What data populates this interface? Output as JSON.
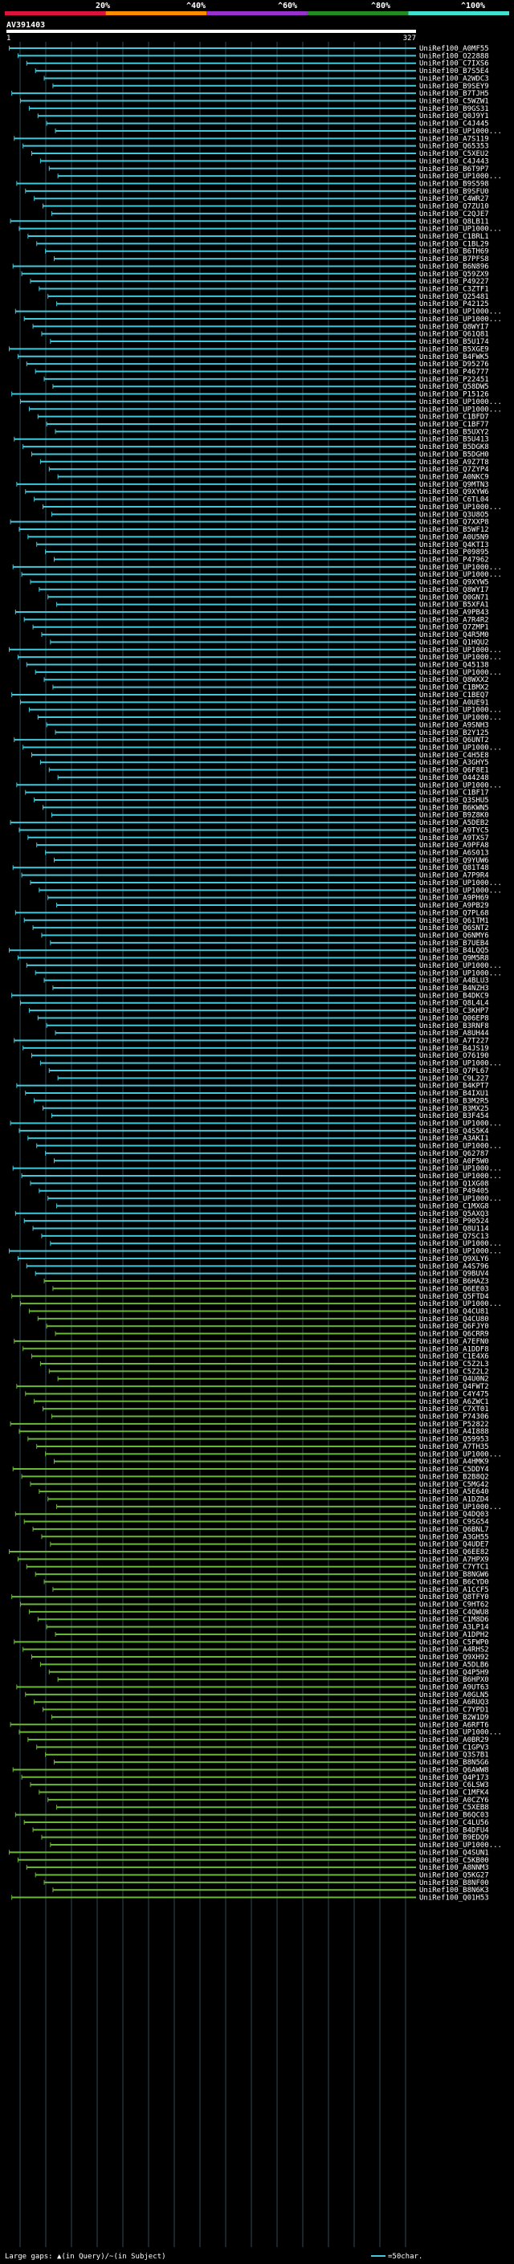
{
  "chart_data": {
    "type": "alignment",
    "query_id": "AV391403",
    "query_start": "1",
    "query_end": "327",
    "identity_scale": [
      "20%",
      "^40%",
      "^60%",
      "^80%",
      "^100%"
    ],
    "colors": {
      "scale": [
        "#dc143c",
        "#ff8c00",
        "#9932cc",
        "#228b22",
        "#40e0d0"
      ],
      "cyan_hit": "#40c8dc",
      "green_hit": "#6ab838",
      "gridline": "#2e4a5a",
      "axis": "#ffffff"
    },
    "footer": {
      "gaps": "Large gaps: ▲(in Query)/~(in Subject)",
      "legend": "=50char."
    },
    "groups": [
      {
        "color": "cyan",
        "labels": [
          "UniRef100_A0MF55",
          "UniRef100_O22888",
          "UniRef100_C7IXS6",
          "UniRef100_B7S5E4",
          "UniRef100_A2WDC3",
          "UniRef100_B9SEY9",
          "UniRef100_B7TJH5",
          "UniRef100_C5WZW1",
          "UniRef100_B9GS31",
          "UniRef100_Q0J9Y1",
          "UniRef100_C4J445",
          "UniRef100_UP1000...",
          "UniRef100_A7S119",
          "UniRef100_Q65353",
          "UniRef100_C5XEU2",
          "UniRef100_C4J443",
          "UniRef100_B6T9P7",
          "UniRef100_UP1000...",
          "UniRef100_B9S598",
          "UniRef100_B9SFU0",
          "UniRef100_C4WR27",
          "UniRef100_Q7ZU10",
          "UniRef100_C2QJE7",
          "UniRef100_Q8LB11",
          "UniRef100_UP1000...",
          "UniRef100_C1BRL1",
          "UniRef100_C1BL29",
          "UniRef100_B6TH69",
          "UniRef100_B7PFS8",
          "UniRef100_B6N896",
          "UniRef100_Q59ZX9",
          "UniRef100_P49227",
          "UniRef100_C3ZTF1",
          "UniRef100_Q25481",
          "UniRef100_P42125",
          "UniRef100_UP1000...",
          "UniRef100_UP1000...",
          "UniRef100_Q8WYI7",
          "UniRef100_Q61Q81",
          "UniRef100_B5U174",
          "UniRef100_B5XGE9",
          "UniRef100_B4FWK5",
          "UniRef100_D95276",
          "UniRef100_P46777",
          "UniRef100_P22451",
          "UniRef100_Q58DW5",
          "UniRef100_P15126",
          "UniRef100_UP1000...",
          "UniRef100_UP1000...",
          "UniRef100_C1BFD7",
          "UniRef100_C1BF77",
          "UniRef100_B5UXY2",
          "UniRef100_B5U413",
          "UniRef100_B5DGK8",
          "UniRef100_B5DGH0",
          "UniRef100_A9Z7T8",
          "UniRef100_Q7ZYP4",
          "UniRef100_A0NKC9",
          "UniRef100_Q9MTN3",
          "UniRef100_Q9XYW6",
          "UniRef100_C6TL04",
          "UniRef100_UP1000...",
          "UniRef100_Q3U8O5",
          "UniRef100_Q7XXP8",
          "UniRef100_B5WF12",
          "UniRef100_A0U5N9",
          "UniRef100_Q4KTI3",
          "UniRef100_P09895",
          "UniRef100_P47962",
          "UniRef100_UP1000...",
          "UniRef100_UP1000...",
          "UniRef100_Q9XYW5",
          "UniRef100_Q8WYI7",
          "UniRef100_Q0GN71",
          "UniRef100_B5XFA1",
          "UniRef100_A9PB43",
          "UniRef100_A7R4R2",
          "UniRef100_Q7ZMP1",
          "UniRef100_Q4R5M0",
          "UniRef100_Q1HQU2",
          "UniRef100_UP1000...",
          "UniRef100_UP1000...",
          "UniRef100_Q45138",
          "UniRef100_UP1000...",
          "UniRef100_Q8WXX2",
          "UniRef100_C1BMX2",
          "UniRef100_C1BEQ7",
          "UniRef100_A0UE91",
          "UniRef100_UP1000...",
          "UniRef100_UP1000...",
          "UniRef100_A9SNH3",
          "UniRef100_B2Y125",
          "UniRef100_Q6UNT2",
          "UniRef100_UP1000...",
          "UniRef100_C4H5E8",
          "UniRef100_A3GHY5",
          "UniRef100_Q6F8E1",
          "UniRef100_O44248",
          "UniRef100_UP1000...",
          "UniRef100_C1BF17",
          "UniRef100_Q3SHU5",
          "UniRef100_B6KWN5",
          "UniRef100_B9Z8K0",
          "UniRef100_A5DEB2",
          "UniRef100_A9TYC5",
          "UniRef100_A9TXS7",
          "UniRef100_A9PFA8",
          "UniRef100_A6S013",
          "UniRef100_Q9YUW6",
          "UniRef100_Q81T48",
          "UniRef100_A7P9R4",
          "UniRef100_UP1000...",
          "UniRef100_UP1000...",
          "UniRef100_A9PH69",
          "UniRef100_A9PB29",
          "UniRef100_Q7PL68",
          "UniRef100_Q61TM1",
          "UniRef100_Q6SNT2",
          "UniRef100_Q6NMY6",
          "UniRef100_B7UEB4",
          "UniRef100_B4LQQ5",
          "UniRef100_Q9M5R8",
          "UniRef100_UP1000...",
          "UniRef100_UP1000...",
          "UniRef100_A4BLU3",
          "UniRef100_B4NZH3",
          "UniRef100_B4DKC9",
          "UniRef100_Q8L4L4",
          "UniRef100_C3KHP7",
          "UniRef100_Q06EP8",
          "UniRef100_B3RNF8",
          "UniRef100_A8UH44",
          "UniRef100_A7T227",
          "UniRef100_B4JS19",
          "UniRef100_O76190",
          "UniRef100_UP1000...",
          "UniRef100_Q7PL67",
          "UniRef100_C9L227",
          "UniRef100_B4KPT7",
          "UniRef100_B4IXU1",
          "UniRef100_B3M2R5",
          "UniRef100_B3MX25",
          "UniRef100_B3F454",
          "UniRef100_UP1000...",
          "UniRef100_Q4S5K4",
          "UniRef100_A3AKI1",
          "UniRef100_UP1000...",
          "UniRef100_Q62787",
          "UniRef100_A0F5W0",
          "UniRef100_UP1000...",
          "UniRef100_UP1000...",
          "UniRef100_Q1XG08",
          "UniRef100_P49405",
          "UniRef100_UP1000...",
          "UniRef100_C1MXG8",
          "UniRef100_Q5AXQ3",
          "UniRef100_P90524",
          "UniRef100_Q8U114",
          "UniRef100_Q7SC13",
          "UniRef100_UP1000...",
          "UniRef100_UP1000...",
          "UniRef100_Q9XLY6",
          "UniRef100_A4S796",
          "UniRef100_Q9BUV4"
        ]
      },
      {
        "color": "green",
        "labels": [
          "UniRef100_B6HAZ3",
          "UniRef100_Q6EE03",
          "UniRef100_Q5FTD4",
          "UniRef100_UP1000...",
          "UniRef100_Q4CU81",
          "UniRef100_Q4CU80",
          "UniRef100_Q6FJY0",
          "UniRef100_Q6CRR9",
          "UniRef100_A7EFN0",
          "UniRef100_A1DDF8",
          "UniRef100_C1E4X6",
          "UniRef100_C5Z2L3",
          "UniRef100_C5Z2L2",
          "UniRef100_Q4U0N2",
          "UniRef100_Q4FWT2",
          "UniRef100_C4Y475",
          "UniRef100_A6ZWC1",
          "UniRef100_C7XT01",
          "UniRef100_P74306",
          "UniRef100_P52822",
          "UniRef100_A4I888",
          "UniRef100_Q59953",
          "UniRef100_A7TH35",
          "UniRef100_UP1000...",
          "UniRef100_A4HMK9",
          "UniRef100_C5DDY4",
          "UniRef100_B2B8Q2",
          "UniRef100_C5MG42",
          "UniRef100_A5E640",
          "UniRef100_A1DZD4",
          "UniRef100_UP1000...",
          "UniRef100_Q4DQ03",
          "UniRef100_C9SG54",
          "UniRef100_Q6BNL7",
          "UniRef100_A3GH55",
          "UniRef100_Q4UDE7",
          "UniRef100_Q6EE82",
          "UniRef100_A7HPX9",
          "UniRef100_C7YTC1",
          "UniRef100_B8NGW6",
          "UniRef100_B6CYD0",
          "UniRef100_A1CCF5",
          "UniRef100_Q8TFY0",
          "UniRef100_C9HT62",
          "UniRef100_C4QWU8",
          "UniRef100_C1M8D6",
          "UniRef100_A3LP14",
          "UniRef100_A1DPH2",
          "UniRef100_C5FWP0",
          "UniRef100_A4RHS2",
          "UniRef100_Q9XH92",
          "UniRef100_A5DLB6",
          "UniRef100_Q4P5H9",
          "UniRef100_B6HPX0",
          "UniRef100_A9UT63",
          "UniRef100_A0GLN5",
          "UniRef100_A6RUQ3",
          "UniRef100_C7YPD1",
          "UniRef100_B2W1D9",
          "UniRef100_A6RFT6",
          "UniRef100_UP1000...",
          "UniRef100_A0BR29",
          "UniRef100_C1GPV3",
          "UniRef100_Q3S7B1",
          "UniRef100_B8N5G6",
          "UniRef100_Q6AWW8",
          "UniRef100_Q4P173",
          "UniRef100_C6LSW3",
          "UniRef100_C1MFK4",
          "UniRef100_A0CZY6",
          "UniRef100_C5XEB8",
          "UniRef100_B6QC03",
          "UniRef100_C4LU56",
          "UniRef100_B4DFU4",
          "UniRef100_B9EDQ9",
          "UniRef100_UP1000...",
          "UniRef100_Q4SUN1",
          "UniRef100_C5KB00",
          "UniRef100_A8NNM3",
          "UniRef100_Q5KG27",
          "UniRef100_B8NF00",
          "UniRef100_B8N6K3",
          "UniRef100_Q01H53"
        ]
      }
    ]
  }
}
